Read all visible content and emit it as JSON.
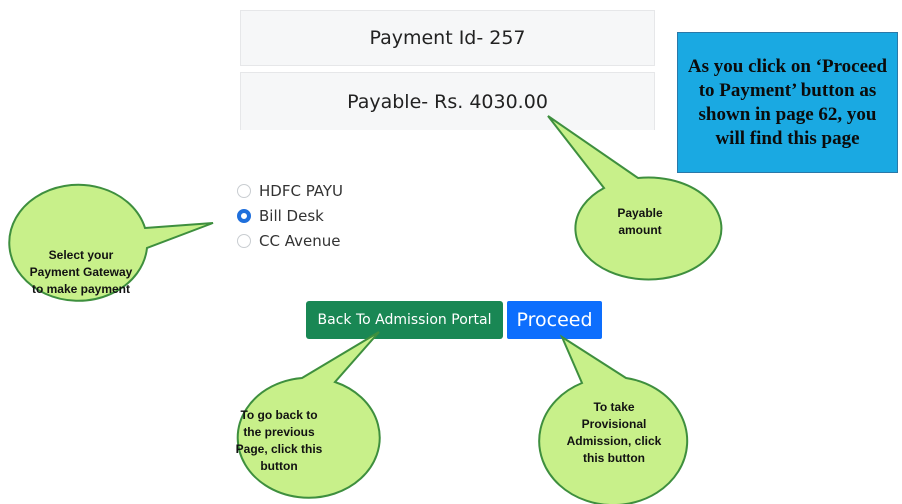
{
  "payment": {
    "id_text": "Payment Id- 257",
    "payable_text": "Payable- Rs. 4030.00"
  },
  "note": {
    "text": "As you click on ‘Proceed to Payment’ button as shown in page 62, you will find this page"
  },
  "gateways": {
    "options": [
      {
        "label": "HDFC PAYU",
        "selected": false
      },
      {
        "label": "Bill Desk",
        "selected": true
      },
      {
        "label": "CC Avenue",
        "selected": false
      }
    ]
  },
  "buttons": {
    "back_label": "Back To Admission Portal",
    "proceed_label": "Proceed"
  },
  "callouts": {
    "gateway": "Select your Payment Gateway to make payment",
    "payable": "Payable amount",
    "back": "To go back to the previous Page, click this button",
    "proceed": "To take Provisional Admission, click this button"
  },
  "colors": {
    "bubble_fill": "#c8f08a",
    "bubble_stroke": "#3e8f3e",
    "back_button": "#198754",
    "proceed_button": "#0d6efd",
    "note_bg": "#1aa9e2"
  }
}
